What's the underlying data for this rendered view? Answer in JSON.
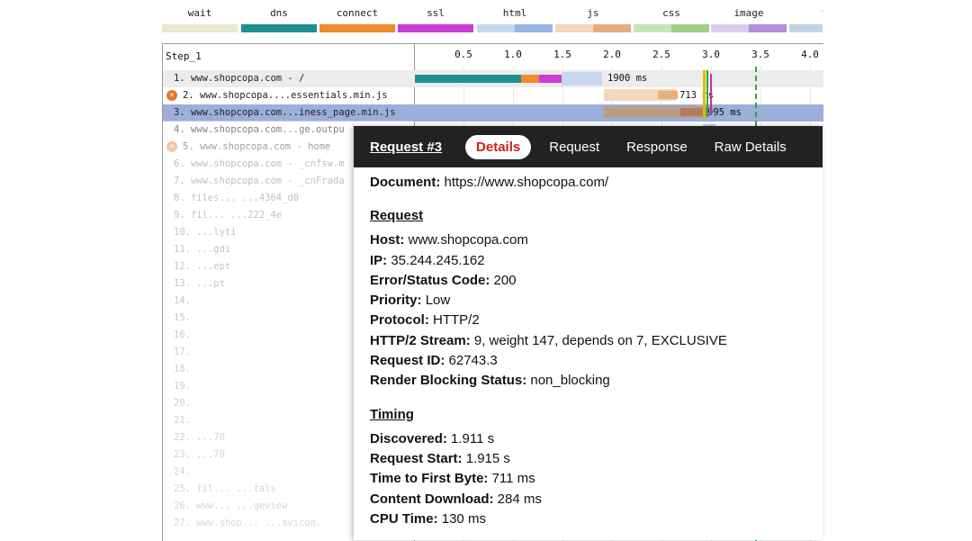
{
  "legend": [
    {
      "name": "legend-wait",
      "label": "wait",
      "colors": [
        "#eae7d1"
      ]
    },
    {
      "name": "legend-dns",
      "label": "dns",
      "colors": [
        "#1f8f90"
      ]
    },
    {
      "name": "legend-connect",
      "label": "connect",
      "colors": [
        "#ee8a2f"
      ]
    },
    {
      "name": "legend-ssl",
      "label": "ssl",
      "colors": [
        "#cc3bd2"
      ]
    },
    {
      "name": "legend-html",
      "label": "html",
      "colors": [
        "#c7d7ee",
        "#95b4e2"
      ]
    },
    {
      "name": "legend-js",
      "label": "js",
      "colors": [
        "#f2d6bd",
        "#e5ae7f"
      ]
    },
    {
      "name": "legend-css",
      "label": "css",
      "colors": [
        "#c7e2b7",
        "#9ecf85"
      ]
    },
    {
      "name": "legend-image",
      "label": "image",
      "colors": [
        "#dccbee",
        "#b48fdd"
      ]
    },
    {
      "name": "legend-fl",
      "label": "fl",
      "colors": [
        "#bdd6e2",
        "#7eb3c8"
      ]
    }
  ],
  "waterfall": {
    "step_label": "Step_1",
    "ticks": [
      "0.5",
      "1.0",
      "1.5",
      "2.0",
      "2.5",
      "3.0",
      "3.5",
      "4.0"
    ],
    "rows": [
      {
        "label": "1. www.shopcopa.com - /",
        "warn": false,
        "highlight": "#ececec",
        "bar_text": "1900 ms"
      },
      {
        "label": "2. www.shopcopa....essentials.min.js",
        "warn": true,
        "highlight": "",
        "bar_text": "713 ms"
      },
      {
        "label": "3. www.shopcopa.com...iness_page.min.js",
        "warn": false,
        "highlight": "#9daeda",
        "bar_text": "995 ms"
      },
      {
        "label": "4. www.shopcopa.com...ge.outpu",
        "warn": false,
        "highlight": "",
        "bar_text": ""
      },
      {
        "label": "5. www.shopcopa.com - home",
        "warn": true,
        "highlight": "",
        "bar_text": ""
      },
      {
        "label": "6. www.shopcopa.com - _cnfsw.m",
        "warn": false,
        "highlight": "",
        "bar_text": ""
      },
      {
        "label": "7. www.shopcopa.com - _cnFrada",
        "warn": false,
        "highlight": "",
        "bar_text": ""
      },
      {
        "label": "8. files...      ...4364_d0",
        "warn": false,
        "highlight": "",
        "bar_text": ""
      },
      {
        "label": "9. fil...      ...222_4e",
        "warn": false,
        "highlight": "",
        "bar_text": ""
      },
      {
        "label": "10.                   ...lyti",
        "warn": false,
        "highlight": "",
        "bar_text": ""
      },
      {
        "label": "11.                    ...gdi",
        "warn": false,
        "highlight": "",
        "bar_text": ""
      },
      {
        "label": "12.                    ...ept",
        "warn": false,
        "highlight": "",
        "bar_text": ""
      },
      {
        "label": "13.                     ...pt",
        "warn": false,
        "highlight": "",
        "bar_text": ""
      },
      {
        "label": "14.",
        "warn": false,
        "highlight": "",
        "bar_text": ""
      },
      {
        "label": "15.",
        "warn": false,
        "highlight": "",
        "bar_text": ""
      },
      {
        "label": "16.",
        "warn": false,
        "highlight": "",
        "bar_text": ""
      },
      {
        "label": "17.",
        "warn": false,
        "highlight": "",
        "bar_text": ""
      },
      {
        "label": "18.",
        "warn": false,
        "highlight": "",
        "bar_text": ""
      },
      {
        "label": "19.",
        "warn": false,
        "highlight": "",
        "bar_text": ""
      },
      {
        "label": "20.",
        "warn": false,
        "highlight": "",
        "bar_text": ""
      },
      {
        "label": "21.",
        "warn": false,
        "highlight": "",
        "bar_text": ""
      },
      {
        "label": "22.                     ...70",
        "warn": false,
        "highlight": "",
        "bar_text": ""
      },
      {
        "label": "23.                     ...70",
        "warn": false,
        "highlight": "",
        "bar_text": ""
      },
      {
        "label": "24.",
        "warn": false,
        "highlight": "",
        "bar_text": ""
      },
      {
        "label": "25. fil...            ...tals",
        "warn": false,
        "highlight": "",
        "bar_text": ""
      },
      {
        "label": "26. www...            ...geview",
        "warn": false,
        "highlight": "",
        "bar_text": ""
      },
      {
        "label": "27. www.shop...      ...avicon.",
        "warn": false,
        "highlight": "",
        "bar_text": ""
      }
    ]
  },
  "popup": {
    "title": "Request #3",
    "tabs": [
      {
        "name": "tab-details",
        "label": "Details",
        "active": true
      },
      {
        "name": "tab-request",
        "label": "Request",
        "active": false
      },
      {
        "name": "tab-response",
        "label": "Response",
        "active": false
      },
      {
        "name": "tab-raw-details",
        "label": "Raw Details",
        "active": false
      }
    ],
    "document_label": "Document:",
    "document_value": "https://www.shopcopa.com/",
    "request_heading": "Request",
    "request_fields": [
      {
        "key": "Host:",
        "value": "www.shopcopa.com"
      },
      {
        "key": "IP:",
        "value": "35.244.245.162"
      },
      {
        "key": "Error/Status Code:",
        "value": "200"
      },
      {
        "key": "Priority:",
        "value": "Low"
      },
      {
        "key": "Protocol:",
        "value": "HTTP/2"
      },
      {
        "key": "HTTP/2 Stream:",
        "value": "9, weight 147, depends on 7, EXCLUSIVE"
      },
      {
        "key": "Request ID:",
        "value": "62743.3"
      },
      {
        "key": "Render Blocking Status:",
        "value": "non_blocking"
      }
    ],
    "timing_heading": "Timing",
    "timing_fields": [
      {
        "key": "Discovered:",
        "value": "1.911 s"
      },
      {
        "key": "Request Start:",
        "value": "1.915 s"
      },
      {
        "key": "Time to First Byte:",
        "value": "711 ms"
      },
      {
        "key": "Content Download:",
        "value": "284 ms"
      },
      {
        "key": "CPU Time:",
        "value": "130 ms"
      }
    ]
  }
}
